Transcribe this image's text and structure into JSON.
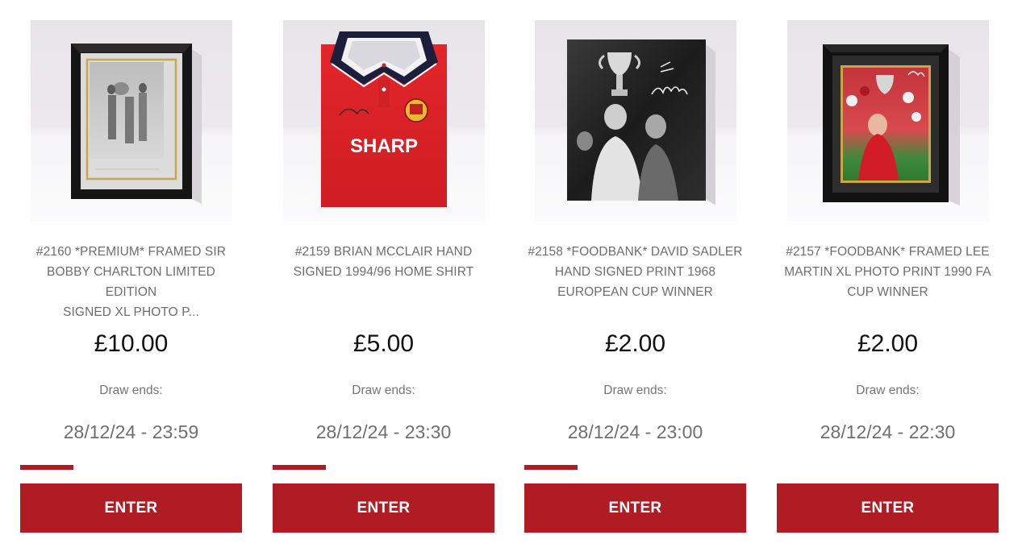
{
  "competitions": [
    {
      "image": "framed-photo-bobby-charlton",
      "title_lines": [
        "#2160 *PREMIUM* FRAMED SIR",
        "BOBBY CHARLTON LIMITED EDITION",
        "SIGNED XL PHOTO P..."
      ],
      "price": "£10.00",
      "draw_label": "Draw ends:",
      "draw_date": "28/12/24 - 23:59",
      "progress_fraction": 0.24,
      "button_label": "ENTER"
    },
    {
      "image": "signed-red-home-shirt",
      "title_lines": [
        "#2159 BRIAN MCCLAIR HAND",
        "SIGNED 1994/96 HOME SHIRT"
      ],
      "price": "£5.00",
      "draw_label": "Draw ends:",
      "draw_date": "28/12/24 - 23:30",
      "progress_fraction": 0.24,
      "button_label": "ENTER",
      "shirt_sponsor": "SHARP"
    },
    {
      "image": "signed-bw-print-trophy",
      "title_lines": [
        "#2158 *FOODBANK* DAVID SADLER",
        "HAND SIGNED PRINT 1968",
        "EUROPEAN CUP WINNER"
      ],
      "price": "£2.00",
      "draw_label": "Draw ends:",
      "draw_date": "28/12/24 - 23:00",
      "progress_fraction": 0.24,
      "button_label": "ENTER"
    },
    {
      "image": "framed-colour-photo-fa-cup",
      "title_lines": [
        "#2157 *FOODBANK* FRAMED LEE",
        "MARTIN XL PHOTO PRINT 1990 FA",
        "CUP WINNER"
      ],
      "price": "£2.00",
      "draw_label": "Draw ends:",
      "draw_date": "28/12/24 - 22:30",
      "progress_fraction": 0,
      "button_label": "ENTER"
    }
  ],
  "colors": {
    "accent": "#b01c24",
    "title_text": "#6d6d6d",
    "price_text": "#111111"
  }
}
